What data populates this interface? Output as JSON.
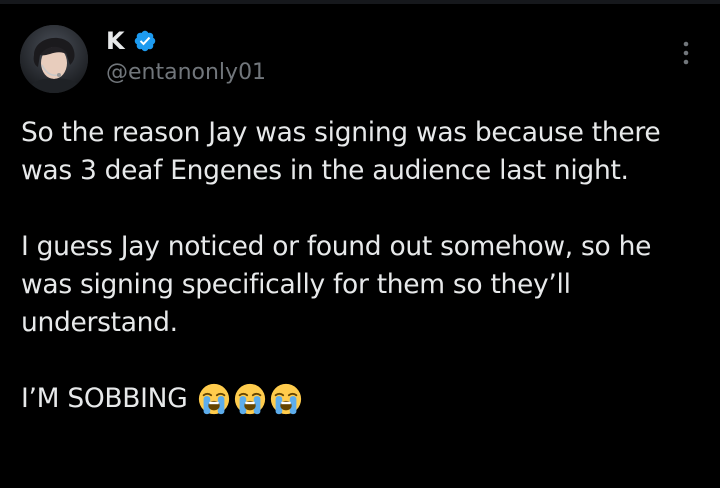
{
  "author": {
    "display_name": "K",
    "handle": "@entanonly01",
    "verified": true,
    "verified_color": "#1d9bf0"
  },
  "menu": {
    "icon": "more-vertical-icon"
  },
  "tweet": {
    "paragraphs": [
      "So the reason Jay was signing was because there was 3 deaf Engenes in the audience last night.",
      "I guess Jay noticed or found out somehow, so he was signing specifically for them so they’ll understand."
    ],
    "closing_text": "I’M SOBBING",
    "emojis": [
      "loudly-crying-face",
      "loudly-crying-face",
      "loudly-crying-face"
    ]
  },
  "colors": {
    "background": "#000000",
    "text_primary": "#e7e9ea",
    "text_secondary": "#71767b",
    "accent": "#1d9bf0"
  }
}
